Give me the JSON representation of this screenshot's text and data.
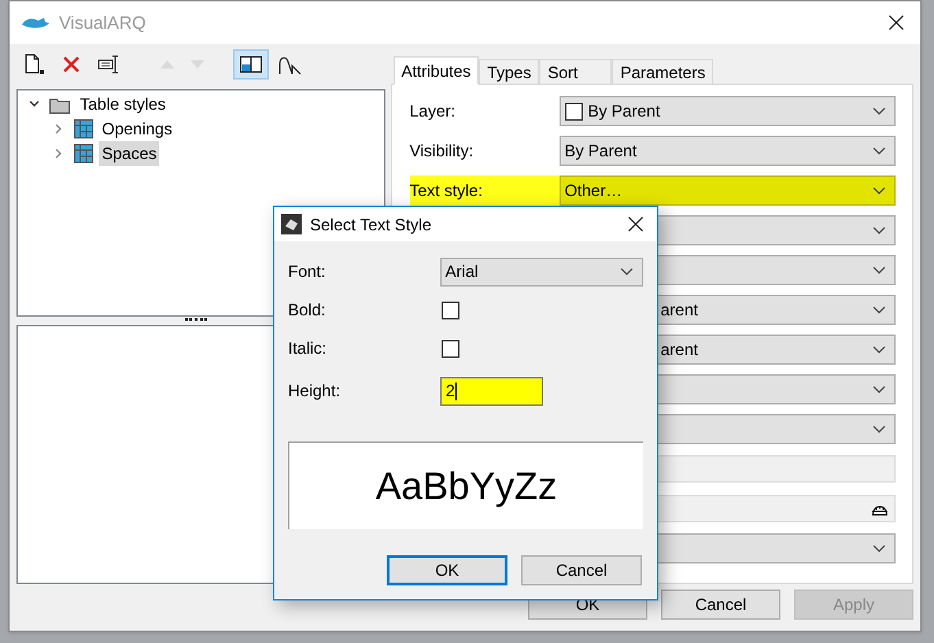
{
  "window": {
    "title": "VisualARQ"
  },
  "toolbar": [
    {
      "kind": "new",
      "disabled": false,
      "selected": false
    },
    {
      "kind": "delete",
      "disabled": false,
      "selected": false
    },
    {
      "kind": "rename",
      "disabled": false,
      "selected": false
    },
    {
      "kind": "up",
      "disabled": true,
      "selected": false
    },
    {
      "kind": "down",
      "disabled": true,
      "selected": false
    },
    {
      "kind": "layout",
      "disabled": false,
      "selected": true
    },
    {
      "kind": "curve",
      "disabled": false,
      "selected": false
    }
  ],
  "tree": [
    {
      "label": "Table styles",
      "expanded": true,
      "selected": false,
      "children": [
        {
          "label": "Openings",
          "expanded": false,
          "selected": false
        },
        {
          "label": "Spaces",
          "expanded": false,
          "selected": true
        }
      ]
    }
  ],
  "tabs": [
    {
      "label": "Attributes",
      "selected": true
    },
    {
      "label": "Types",
      "selected": false
    },
    {
      "label": "Sort",
      "selected": false
    },
    {
      "label": "Parameters",
      "selected": false
    }
  ],
  "properties": [
    {
      "kind": "layer",
      "label": "Layer:",
      "value": "By Parent",
      "highlighted": false
    },
    {
      "kind": "dropdown",
      "label": "Visibility:",
      "value": "By Parent",
      "highlighted": false
    },
    {
      "kind": "dropdown",
      "label": "Text style:",
      "value": "Other…",
      "highlighted": true
    },
    {
      "kind": "dropdown",
      "highlighted": false
    },
    {
      "kind": "dropdown",
      "highlighted": false
    },
    {
      "kind": "dropdown",
      "value": "arent",
      "highlighted": false
    },
    {
      "kind": "dropdown",
      "value": "arent",
      "highlighted": false
    },
    {
      "kind": "dropdown",
      "highlighted": false
    },
    {
      "kind": "dropdown",
      "highlighted": false
    },
    {
      "kind": "text",
      "highlighted": false
    },
    {
      "kind": "picker",
      "highlighted": false
    },
    {
      "kind": "dropdown",
      "highlighted": false
    }
  ],
  "buttons": [
    {
      "label": "OK",
      "disabled": false
    },
    {
      "label": "Cancel",
      "disabled": false
    },
    {
      "label": "Apply",
      "disabled": true
    }
  ],
  "dialog": {
    "title": "Select Text Style",
    "font": {
      "label": "Font:",
      "value": "Arial"
    },
    "bold": {
      "label": "Bold:",
      "checked": false
    },
    "italic": {
      "label": "Italic:",
      "checked": false
    },
    "height": {
      "label": "Height:",
      "value": "2",
      "highlighted": true
    },
    "preview": "AaBbYyZz",
    "buttons": [
      {
        "label": "OK",
        "default": true
      },
      {
        "label": "Cancel",
        "default": false
      }
    ]
  }
}
